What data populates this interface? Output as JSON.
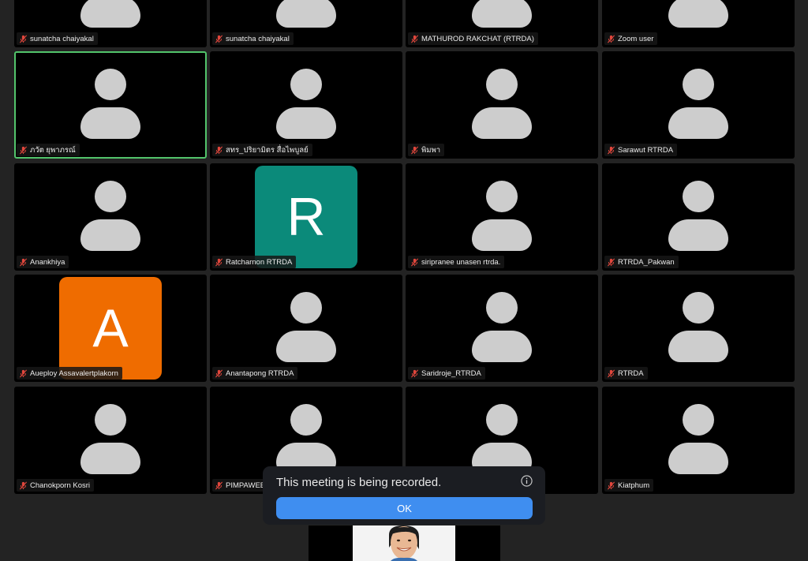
{
  "tiles": [
    {
      "name": "sunatcha chaiyakal"
    },
    {
      "name": "sunatcha chaiyakal"
    },
    {
      "name": "MATHUROD RAKCHAT (RTRDA)"
    },
    {
      "name": "Zoom user"
    },
    {
      "name": "ภวัต ยุพาภรณ์",
      "active": true
    },
    {
      "name": "สทร_ปริยามิตร สื่อไพบูลย์"
    },
    {
      "name": "พิมพา"
    },
    {
      "name": "Sarawut RTRDA"
    },
    {
      "name": "Anankhiya"
    },
    {
      "name": "Ratcharnon RTRDA",
      "initial": "R",
      "initial_color": "#0b8a7a"
    },
    {
      "name": "siripranee unasen rtrda."
    },
    {
      "name": "RTRDA_Pakwan"
    },
    {
      "name": "Aueploy Assavalertplakorn",
      "initial": "A",
      "initial_color": "#ef6c00"
    },
    {
      "name": "Anantapong RTRDA"
    },
    {
      "name": "Saridroje_RTRDA"
    },
    {
      "name": "RTRDA"
    },
    {
      "name": "Chanokporn Kosri"
    },
    {
      "name": "PIMPAWEE"
    },
    {
      "name": ""
    },
    {
      "name": "Kiatphum"
    }
  ],
  "dialog": {
    "message": "This meeting is being recorded.",
    "ok_label": "OK",
    "info_icon": "info-icon"
  },
  "colors": {
    "active_border": "#52c46b",
    "ok_button": "#3f8ef0",
    "mic_muted": "#e0463c"
  }
}
